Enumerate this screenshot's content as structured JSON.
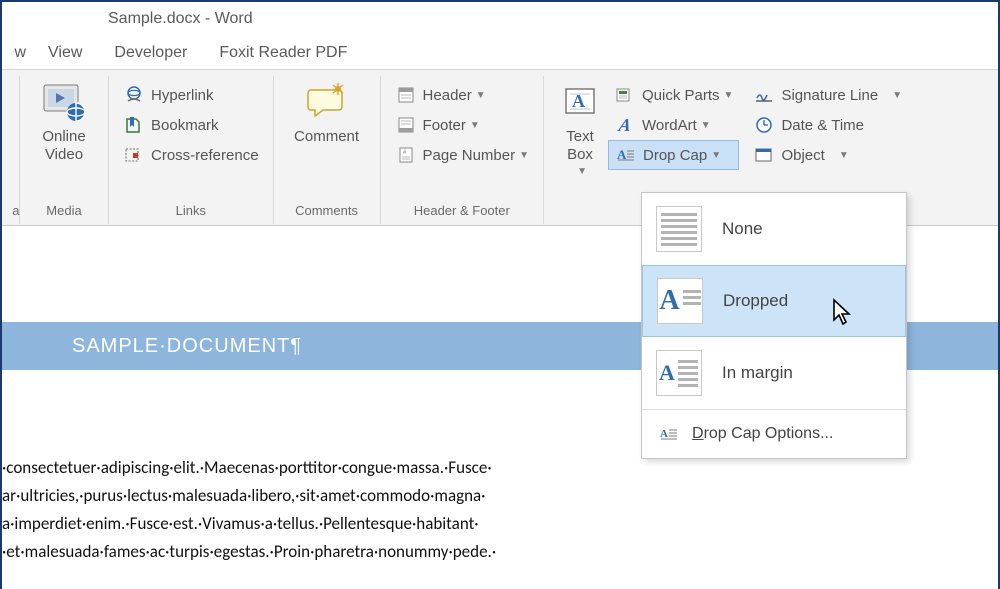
{
  "title": "Sample.docx - Word",
  "tabs": {
    "frag": "w",
    "view": "View",
    "developer": "Developer",
    "foxit": "Foxit Reader PDF"
  },
  "ribbon": {
    "media": {
      "group": "Media",
      "frag": "a",
      "video": "Online\nVideo"
    },
    "links": {
      "group": "Links",
      "hyperlink": "Hyperlink",
      "bookmark": "Bookmark",
      "crossref": "Cross-reference"
    },
    "comments": {
      "group": "Comments",
      "comment": "Comment"
    },
    "hf": {
      "group": "Header & Footer",
      "header": "Header",
      "footer": "Footer",
      "pagenum": "Page Number"
    },
    "text": {
      "textbox": "Text\nBox",
      "quickparts": "Quick Parts",
      "wordart": "WordArt",
      "dropcap": "Drop Cap",
      "sigline": "Signature Line",
      "datetime": "Date & Time",
      "object": "Object"
    }
  },
  "dropdown": {
    "none": "None",
    "dropped": "Dropped",
    "inmargin": "In margin",
    "options": "Drop Cap Options..."
  },
  "document": {
    "heading": "SAMPLE·DOCUMENT¶",
    "line1": "·consectetuer·adipiscing·elit.·Maecenas·porttitor·congue·massa.·Fusce·",
    "line2": "ar·ultricies,·purus·lectus·malesuada·libero,·sit·amet·commodo·magna·",
    "line3": "a·imperdiet·enim.·Fusce·est.·Vivamus·a·tellus.·Pellentesque·habitant·",
    "line4": "·et·malesuada·fames·ac·turpis·egestas.·Proin·pharetra·nonummy·pede.·"
  }
}
